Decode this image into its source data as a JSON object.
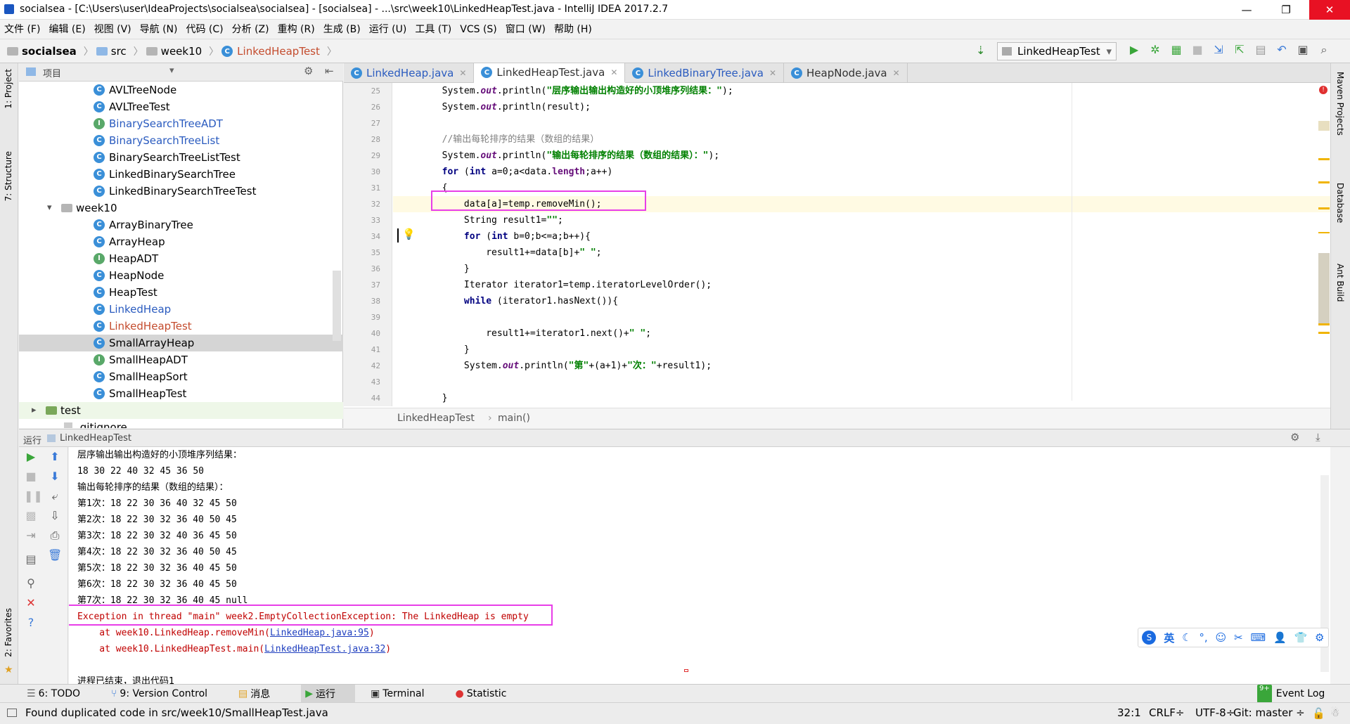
{
  "window": {
    "title": "socialsea - [C:\\Users\\user\\IdeaProjects\\socialsea\\socialsea] - [socialsea] - ...\\src\\week10\\LinkedHeapTest.java - IntelliJ IDEA 2017.2.7"
  },
  "menu": [
    "文件 (F)",
    "编辑 (E)",
    "视图 (V)",
    "导航 (N)",
    "代码 (C)",
    "分析 (Z)",
    "重构 (R)",
    "生成 (B)",
    "运行 (U)",
    "工具 (T)",
    "VCS (S)",
    "窗口 (W)",
    "帮助 (H)"
  ],
  "breadcrumb": {
    "project": "socialsea",
    "src": "src",
    "pkg": "week10",
    "file": "LinkedHeapTest"
  },
  "run_config": "LinkedHeapTest",
  "left_strip": {
    "project": "1: Project",
    "structure": "7: Structure",
    "favorites": "2: Favorites"
  },
  "right_strip": {
    "maven": "Maven Projects",
    "database": "Database",
    "ant": "Ant Build"
  },
  "project_panel": {
    "header": "项目",
    "items": [
      {
        "name": "AVLTreeNode",
        "kind": "c",
        "style": "normal",
        "indent": 2
      },
      {
        "name": "AVLTreeTest",
        "kind": "c",
        "style": "normal",
        "indent": 2
      },
      {
        "name": "BinarySearchTreeADT",
        "kind": "i",
        "style": "link",
        "indent": 2
      },
      {
        "name": "BinarySearchTreeList",
        "kind": "c",
        "style": "link",
        "indent": 2
      },
      {
        "name": "BinarySearchTreeListTest",
        "kind": "c",
        "style": "normal",
        "indent": 2
      },
      {
        "name": "LinkedBinarySearchTree",
        "kind": "c",
        "style": "normal",
        "indent": 2
      },
      {
        "name": "LinkedBinarySearchTreeTest",
        "kind": "c",
        "style": "normal",
        "indent": 2
      },
      {
        "name": "week10",
        "kind": "folder",
        "style": "normal",
        "indent": 1
      },
      {
        "name": "ArrayBinaryTree",
        "kind": "c",
        "style": "normal",
        "indent": 2
      },
      {
        "name": "ArrayHeap",
        "kind": "c",
        "style": "normal",
        "indent": 2
      },
      {
        "name": "HeapADT",
        "kind": "i",
        "style": "normal",
        "indent": 2
      },
      {
        "name": "HeapNode",
        "kind": "c",
        "style": "normal",
        "indent": 2
      },
      {
        "name": "HeapTest",
        "kind": "c",
        "style": "normal",
        "indent": 2
      },
      {
        "name": "LinkedHeap",
        "kind": "c",
        "style": "link",
        "indent": 2
      },
      {
        "name": "LinkedHeapTest",
        "kind": "c",
        "style": "red",
        "indent": 2
      },
      {
        "name": "SmallArrayHeap",
        "kind": "c",
        "style": "selected",
        "indent": 2
      },
      {
        "name": "SmallHeapADT",
        "kind": "i",
        "style": "normal",
        "indent": 2
      },
      {
        "name": "SmallHeapSort",
        "kind": "c",
        "style": "normal",
        "indent": 2
      },
      {
        "name": "SmallHeapTest",
        "kind": "c",
        "style": "normal",
        "indent": 2
      },
      {
        "name": "test",
        "kind": "folder",
        "style": "green",
        "indent": 0
      },
      {
        "name": ".gitignore",
        "kind": "file",
        "style": "normal",
        "indent": 1
      }
    ]
  },
  "editor": {
    "tabs": [
      {
        "label": "LinkedHeap.java",
        "active": false
      },
      {
        "label": "LinkedHeapTest.java",
        "active": true
      },
      {
        "label": "LinkedBinaryTree.java",
        "active": false
      },
      {
        "label": "HeapNode.java",
        "active": false
      }
    ],
    "line_numbers": [
      "25",
      "26",
      "27",
      "28",
      "29",
      "30",
      "31",
      "32",
      "33",
      "34",
      "35",
      "36",
      "37",
      "38",
      "39",
      "40",
      "41",
      "42",
      "43",
      "44"
    ],
    "breadcrumb": {
      "cls": "LinkedHeapTest",
      "method": "main()"
    }
  },
  "code": {
    "l25": {
      "a": "        System.",
      "b": "out",
      "c": ".println(",
      "d": "\"层序输出输出构造好的小顶堆序列结果：\"",
      "e": ");"
    },
    "l26": {
      "a": "        System.",
      "b": "out",
      "c": ".println(result);"
    },
    "l28": "        //输出每轮排序的结果（数组的结果）",
    "l29": {
      "a": "        System.",
      "b": "out",
      "c": ".println(",
      "d": "\"输出每轮排序的结果（数组的结果）：\"",
      "e": ");"
    },
    "l30": {
      "a": "        ",
      "k1": "for",
      "b": " (",
      "k2": "int",
      "c": " a=0;a<data.",
      "f": "length",
      "d": ";a++)"
    },
    "l31": "        {",
    "l32": "            data[a]=temp.removeMin();",
    "l33": {
      "a": "            String result1=",
      "d": "\"\"",
      "e": ";"
    },
    "l34": {
      "a": "            ",
      "k1": "for",
      "b": " (",
      "k2": "int",
      "c": " b=0;b<=a;b++){"
    },
    "l35": {
      "a": "                result1+=data[b]+",
      "d": "\" \"",
      "e": ";"
    },
    "l36": "            }",
    "l37": "            Iterator iterator1=temp.iteratorLevelOrder();",
    "l38": {
      "a": "            ",
      "k1": "while",
      "c": " (iterator1.hasNext()){"
    },
    "l40": {
      "a": "                result1+=iterator1.next()+",
      "d": "\" \"",
      "e": ";"
    },
    "l41": "            }",
    "l42": {
      "a": "            System.",
      "b": "out",
      "c": ".println(",
      "d1": "\"第\"",
      "m": "+(a+1)+",
      "d2": "\"次：\"",
      "e": "+result1);"
    },
    "l44": "        }"
  },
  "run": {
    "header_label": "运行",
    "header_config": "LinkedHeapTest",
    "output": [
      "层序输出输出构造好的小顶堆序列结果：",
      "18 30 22 40 32 45 36 50",
      "输出每轮排序的结果（数组的结果）：",
      "第1次：18 22 30 36 40 32 45 50",
      "第2次：18 22 30 32 36 40 50 45",
      "第3次：18 22 30 32 40 36 45 50",
      "第4次：18 22 30 32 36 40 50 45",
      "第5次：18 22 30 32 36 40 45 50",
      "第6次：18 22 30 32 36 40 45 50",
      "第7次：18 22 30 32 36 40 45 null"
    ],
    "exception": "Exception in thread \"main\" week2.EmptyCollectionException: The LinkedHeap is empty",
    "trace": [
      {
        "prefix": "    at week10.LinkedHeap.removeMin(",
        "link": "LinkedHeap.java:95",
        "suffix": ")"
      },
      {
        "prefix": "    at week10.LinkedHeapTest.main(",
        "link": "LinkedHeapTest.java:32",
        "suffix": ")"
      }
    ],
    "exit": "进程已结束，退出代码1"
  },
  "bottom_tabs": [
    "6: TODO",
    "9: Version Control",
    "消息",
    "运行",
    "Terminal",
    "Statistic"
  ],
  "event_log": "Event Log",
  "status": {
    "message": "Found duplicated code in src/week10/SmallHeapTest.java",
    "position": "32:1",
    "line_sep": "CRLF÷",
    "encoding": "UTF-8÷",
    "git": "Git: master ÷"
  },
  "ime": {
    "lang": "英"
  },
  "colors": {
    "highlight": "#e83ee8",
    "accent": "#3a8fd8",
    "keyword": "#000080",
    "string": "#008000",
    "error": "#c00000"
  }
}
